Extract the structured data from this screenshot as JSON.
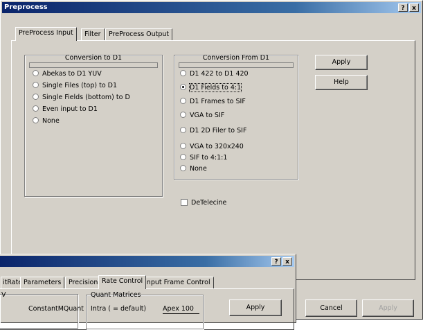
{
  "main_window": {
    "title": "Preprocess",
    "help_btn": "?",
    "close_btn": "x",
    "tabs": [
      "PreProcess Input",
      "Filter",
      "PreProcess Output"
    ],
    "active_tab": 0,
    "conversion_to": {
      "title": "Conversion to D1",
      "options": [
        "Abekas to D1 YUV",
        "Single Files (top) to D1",
        "Single Fields (bottom) to D",
        "Even input to D1",
        "None"
      ],
      "selected": -1
    },
    "conversion_from": {
      "title": "Conversion From D1",
      "options": [
        "D1 422 to D1 420",
        "D1 Fields to 4:1",
        "D1 Frames to SIF",
        "VGA to SIF",
        "D1 2D Filer to SIF",
        "VGA to 320x240",
        "SIF to 4:1:1",
        "None"
      ],
      "selected": 1
    },
    "apply_label": "Apply",
    "help_label": "Help",
    "detelecine_label": "DeTelecine",
    "detelecine_checked": false,
    "cancel_label": "Cancel",
    "apply_bottom_label": "Apply"
  },
  "second_window": {
    "help_btn": "?",
    "close_btn": "x",
    "tabs": [
      "itRate",
      "Parameters",
      "Precision",
      "Rate Control",
      "Input Frame Control"
    ],
    "active_tab": 3,
    "left_label": "V",
    "constant_label": "ConstantMQuant",
    "quant_group_title": "Quant Matrices",
    "intra_label": "Intra ( = default)",
    "intra_value": "Apex 100",
    "apply_label": "Apply"
  }
}
